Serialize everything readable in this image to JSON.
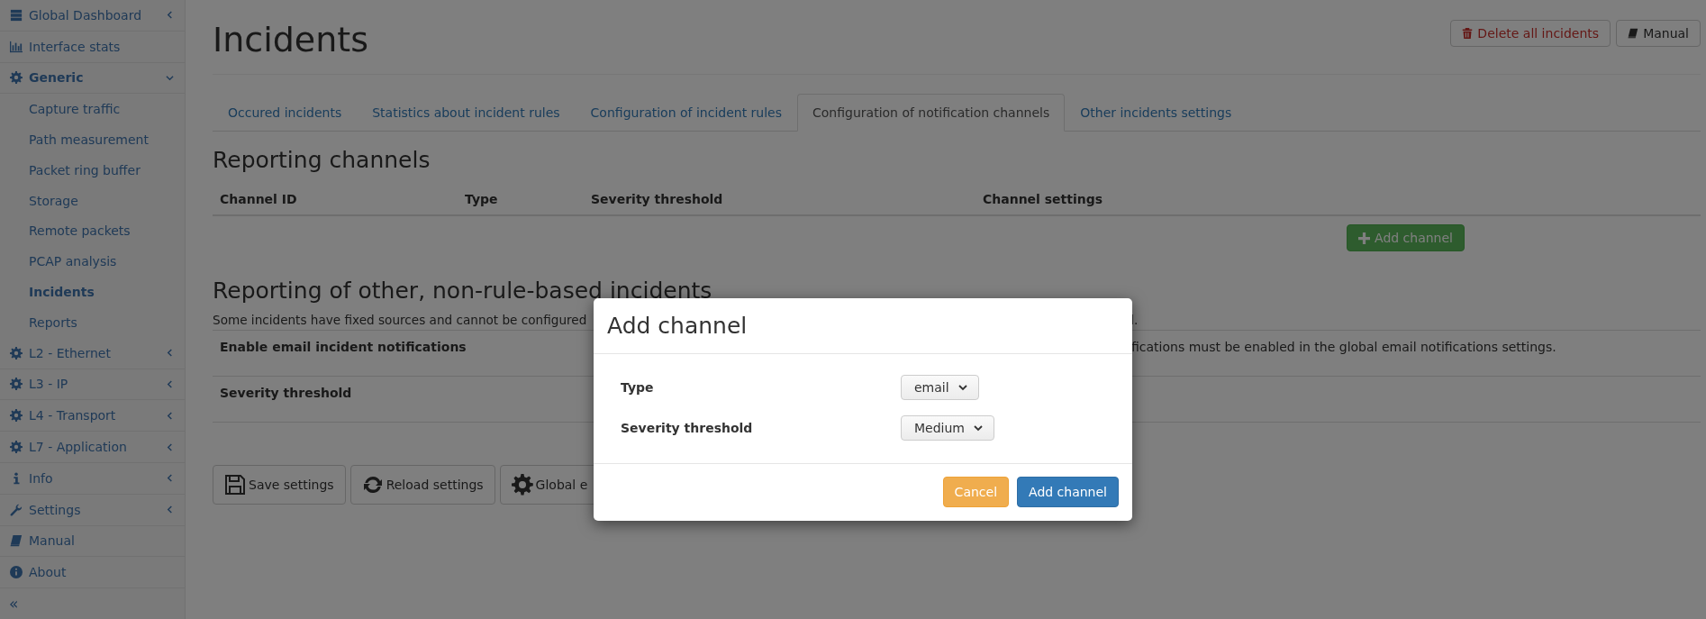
{
  "sidebar": {
    "items": [
      {
        "label": "Global Dashboard",
        "expanded": false
      },
      {
        "label": "Interface stats"
      },
      {
        "label": "Generic",
        "expanded": true,
        "children": [
          {
            "label": "Capture traffic",
            "selected": false
          },
          {
            "label": "Path measurement",
            "selected": false
          },
          {
            "label": "Packet ring buffer",
            "selected": false
          },
          {
            "label": "Storage",
            "selected": false
          },
          {
            "label": "Remote packets",
            "selected": false
          },
          {
            "label": "PCAP analysis",
            "selected": false
          },
          {
            "label": "Incidents",
            "selected": true
          },
          {
            "label": "Reports",
            "selected": false
          }
        ]
      },
      {
        "label": "L2 - Ethernet",
        "expanded": false
      },
      {
        "label": "L3 - IP",
        "expanded": false
      },
      {
        "label": "L4 - Transport",
        "expanded": false
      },
      {
        "label": "L7 - Application",
        "expanded": false
      },
      {
        "label": "Info",
        "expanded": false
      },
      {
        "label": "Settings",
        "expanded": false
      },
      {
        "label": "Manual"
      },
      {
        "label": "About"
      }
    ],
    "collapse": "«"
  },
  "page": {
    "title": "Incidents",
    "actions": [
      {
        "label": "Delete all incidents",
        "kind": "danger"
      },
      {
        "label": "Manual",
        "kind": "default"
      }
    ]
  },
  "tabs": [
    {
      "label": "Occured incidents",
      "selected": false
    },
    {
      "label": "Statistics about incident rules",
      "selected": false
    },
    {
      "label": "Configuration of incident rules",
      "selected": false
    },
    {
      "label": "Configuration of notification channels",
      "selected": true
    },
    {
      "label": "Other incidents settings",
      "selected": false
    }
  ],
  "reporting_channels": {
    "heading": "Reporting channels",
    "columns": [
      "Channel ID",
      "Type",
      "Severity threshold",
      "Channel settings"
    ],
    "add_button": "Add channel"
  },
  "other_incidents": {
    "heading": "Reporting of other, non-rule-based incidents",
    "description_start": "Some incidents have fixed sources and cannot be configured",
    "description_end": "l.",
    "rows": [
      {
        "label": "Enable email incident notifications",
        "value": "fications must be enabled in the global email notifications settings."
      },
      {
        "label": "Severity threshold"
      }
    ]
  },
  "buttons": [
    {
      "label": "Save settings"
    },
    {
      "label": "Reload settings"
    },
    {
      "label": "Global e"
    }
  ],
  "modal": {
    "title": "Add channel",
    "fields": [
      {
        "label": "Type",
        "value": "email"
      },
      {
        "label": "Severity threshold",
        "value": "Medium"
      }
    ],
    "buttons": [
      {
        "label": "Cancel",
        "kind": "warning"
      },
      {
        "label": "Add channel",
        "kind": "primary"
      }
    ]
  }
}
